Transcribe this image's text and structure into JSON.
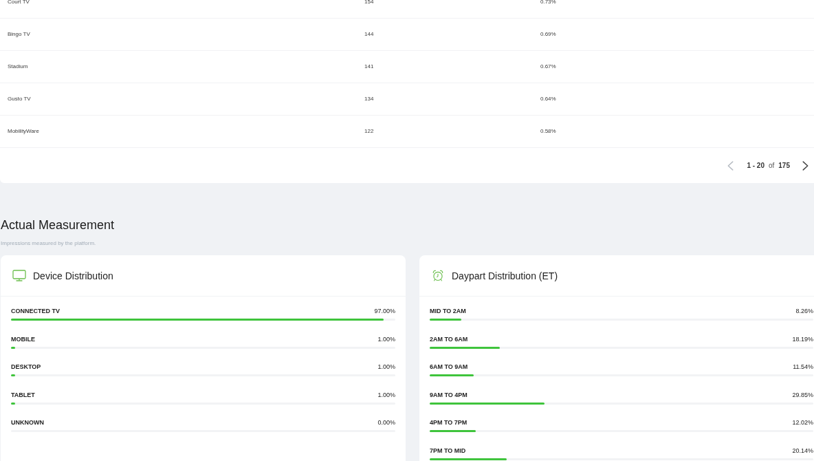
{
  "top_table": {
    "rows": [
      {
        "cells": [
          "Court TV",
          "154",
          "0.73%"
        ]
      },
      {
        "cells": [
          "Bingo TV",
          "144",
          "0.69%"
        ]
      },
      {
        "cells": [
          "Stadium",
          "141",
          "0.67%"
        ]
      },
      {
        "cells": [
          "Gusto TV",
          "134",
          "0.64%"
        ]
      },
      {
        "cells": [
          "MobilityWare",
          "122",
          "0.58%"
        ]
      }
    ],
    "pagination": {
      "prev": {
        "disabled": true
      },
      "range": "1 - 20",
      "of": "of",
      "total": "175",
      "next": {
        "disabled": false
      }
    }
  },
  "section": {
    "title": "Actual Measurement",
    "subtitle": "Impressions measured by the platform."
  },
  "panels": [
    {
      "kind": "device",
      "title": "Device Distribution",
      "items": [
        {
          "label": "CONNECTED TV",
          "value": "97.00%",
          "level": 0.97
        },
        {
          "label": "MOBILE",
          "value": "1.00%",
          "level": 0.01
        },
        {
          "label": "DESKTOP",
          "value": "1.00%",
          "level": 0.01
        },
        {
          "label": "TABLET",
          "value": "1.00%",
          "level": 0.01
        },
        {
          "label": "UNKNOWN",
          "value": "0.00%"
        }
      ]
    },
    {
      "kind": "daypart",
      "title": "Daypart Distribution (ET)",
      "items": [
        {
          "label": "MID TO 2AM",
          "value": "8.26%",
          "level": 0.0826
        },
        {
          "label": "2AM TO 6AM",
          "value": "18.19%",
          "level": 0.1819
        },
        {
          "label": "6AM TO 9AM",
          "value": "11.54%",
          "level": 0.1154
        },
        {
          "label": "9AM TO 4PM",
          "value": "29.85%",
          "level": 0.2985
        },
        {
          "label": "4PM TO 7PM",
          "value": "12.02%",
          "level": 0.1202
        },
        {
          "label": "7PM TO MID",
          "value": "20.14%",
          "level": 0.2014
        }
      ]
    }
  ]
}
